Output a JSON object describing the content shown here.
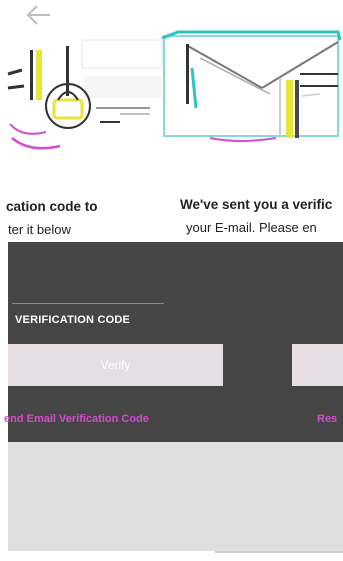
{
  "nav": {
    "back_icon": "arrow-left-icon"
  },
  "illustration": {
    "icon": "envelope-illustration-icon"
  },
  "message": {
    "title_left": "cation code to",
    "title_right": "We've sent you a verific",
    "body_left": "ter it below",
    "body_right": "your E-mail. Please en"
  },
  "form": {
    "code_label": "VERIFICATION CODE",
    "verify_left_label": "Verify",
    "verify_right_label": ""
  },
  "resend": {
    "left_label": "end Email Verification Code",
    "right_label": "Res"
  },
  "colors": {
    "accent": "#d64bd0",
    "dark_panel": "#454545",
    "button": "#e6dee2",
    "illustration_teal": "#2ec4c4",
    "illustration_yellow": "#e8e53a"
  }
}
